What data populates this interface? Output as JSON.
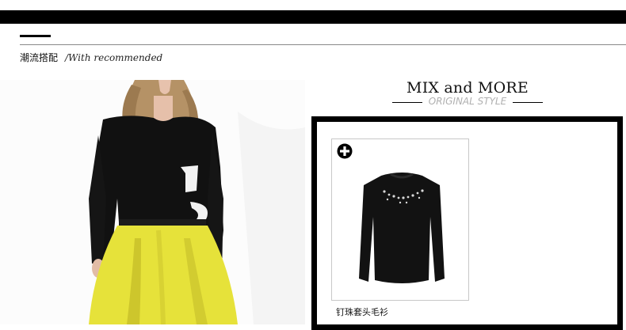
{
  "section": {
    "title_cn": "潮流搭配",
    "title_en": "/With recommended"
  },
  "mix": {
    "title": "MIX and MORE",
    "subtitle": "ORIGINAL STYLE"
  },
  "product": {
    "name": "钉珠套头毛衫"
  },
  "colors": {
    "bar": "#000000",
    "accent_yellow": "#e6e23a",
    "subtitle_gray": "#b0b0b0"
  },
  "icons": {
    "add": "plus-circle-icon"
  }
}
